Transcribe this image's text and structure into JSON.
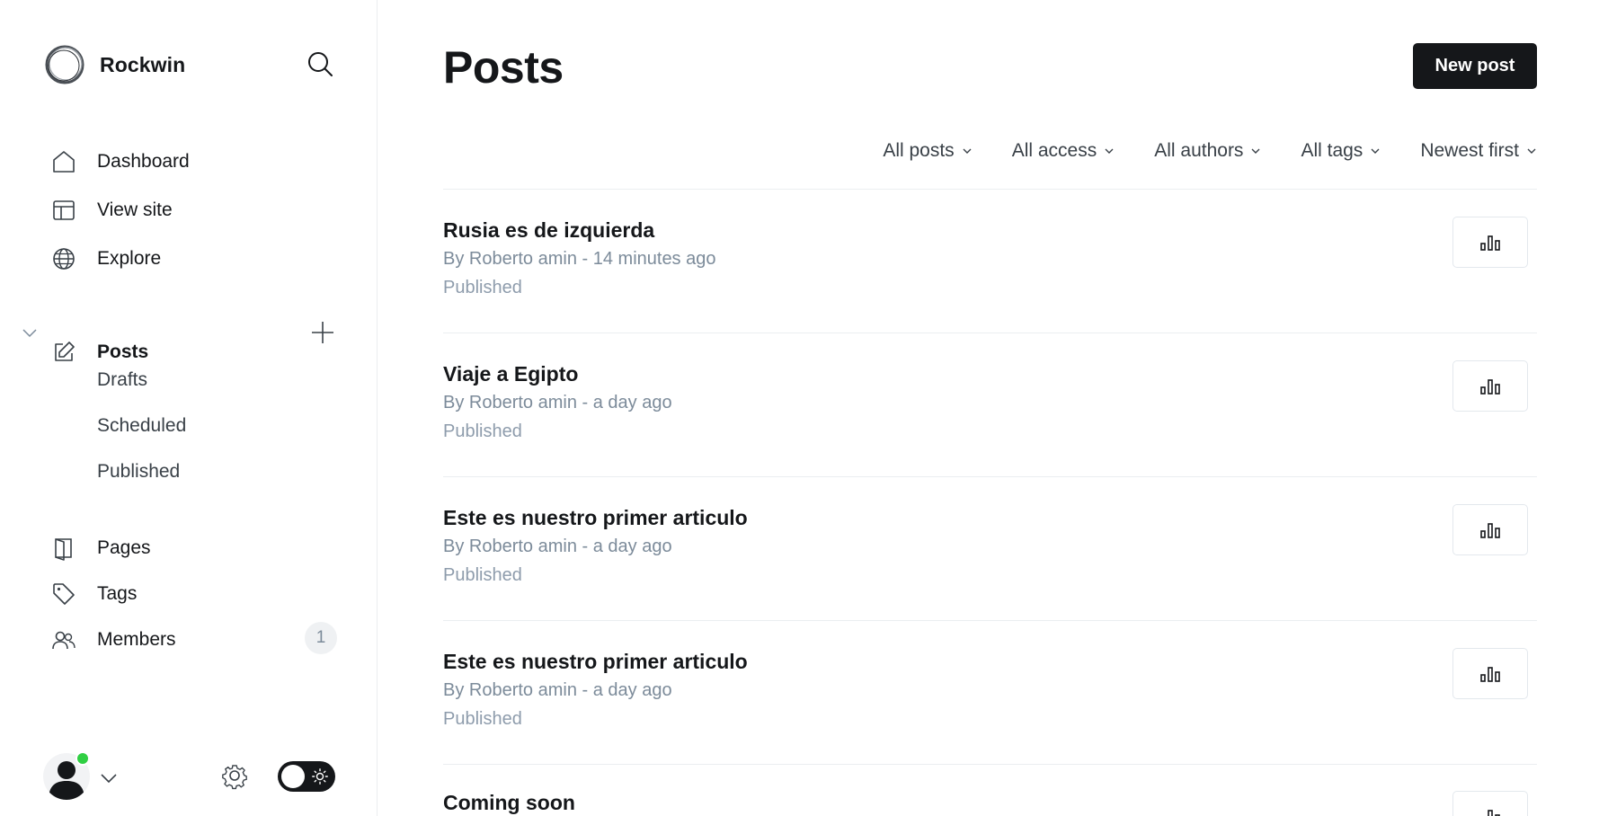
{
  "brand": {
    "name": "Rockwin"
  },
  "nav": {
    "dashboard": "Dashboard",
    "view_site": "View site",
    "explore": "Explore",
    "posts": "Posts",
    "drafts": "Drafts",
    "scheduled": "Scheduled",
    "published": "Published",
    "pages": "Pages",
    "tags": "Tags",
    "members": "Members",
    "members_count": "1"
  },
  "main": {
    "title": "Posts",
    "new_post_label": "New post",
    "filters": [
      "All posts",
      "All access",
      "All authors",
      "All tags",
      "Newest first"
    ]
  },
  "posts": [
    {
      "title": "Rusia es de izquierda",
      "meta": "By Roberto amin - 14 minutes ago",
      "status": "Published"
    },
    {
      "title": "Viaje a Egipto",
      "meta": "By Roberto amin - a day ago",
      "status": "Published"
    },
    {
      "title": "Este es nuestro primer articulo",
      "meta": "By Roberto amin - a day ago",
      "status": "Published"
    },
    {
      "title": "Este es nuestro primer articulo",
      "meta": "By Roberto amin - a day ago",
      "status": "Published"
    },
    {
      "title": "Coming soon",
      "meta": "",
      "status": ""
    }
  ],
  "colors": {
    "accent": "#15171a",
    "online": "#30cf43",
    "muted": "#7c8b9a"
  }
}
